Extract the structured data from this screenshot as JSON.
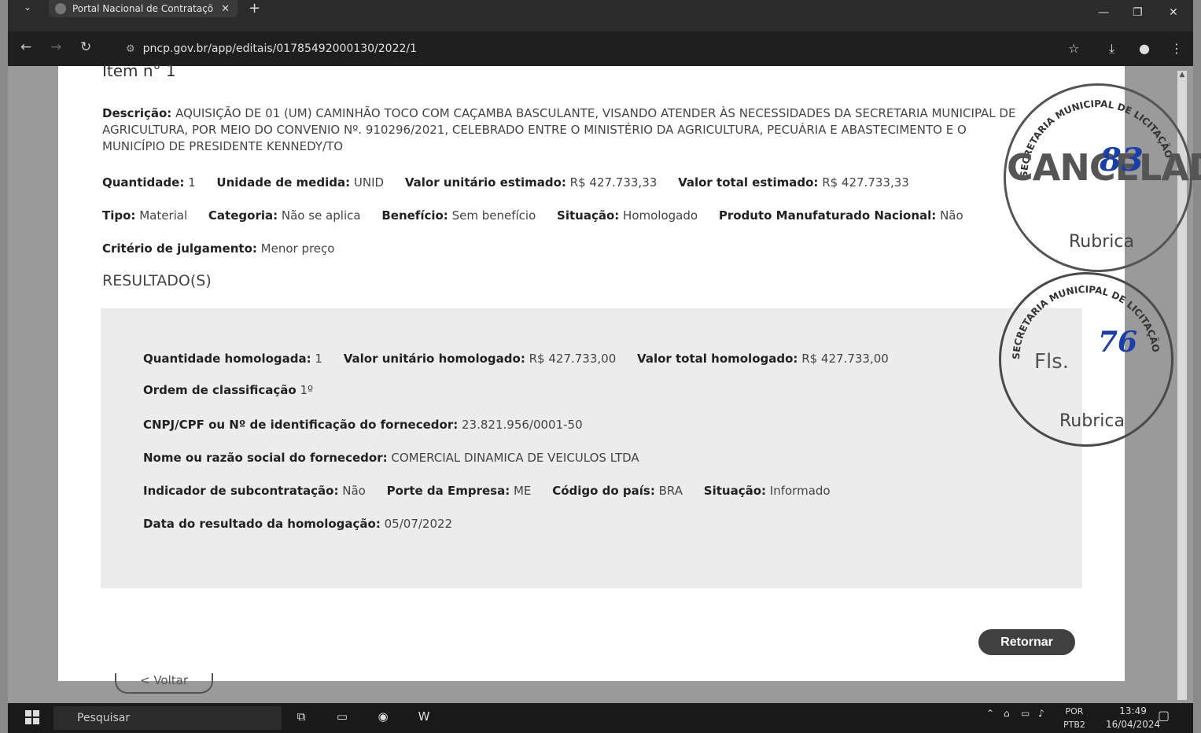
{
  "browser": {
    "tab_title": "Portal Nacional de Contrataçõ",
    "url": "pncp.gov.br/app/editais/01785492000130/2022/1"
  },
  "item": {
    "title": "Item n° 1",
    "descricao_label": "Descrição:",
    "descricao_value": "AQUISIÇÃO DE 01 (UM) CAMINHÃO TOCO COM CAÇAMBA BASCULANTE, VISANDO ATENDER ÀS NECESSIDADES DA SECRETARIA MUNICIPAL DE AGRICULTURA, POR MEIO DO CONVENIO Nº. 910296/2021, CELEBRADO ENTRE O MINISTÉRIO DA AGRICULTURA, PECUÁRIA E ABASTECIMENTO E O MUNICÍPIO DE PRESIDENTE KENNEDY/TO",
    "quantidade_label": "Quantidade:",
    "quantidade_value": "1",
    "unidade_label": "Unidade de medida:",
    "unidade_value": "UNID",
    "valor_unit_label": "Valor unitário estimado:",
    "valor_unit_value": "R$ 427.733,33",
    "valor_total_label": "Valor total estimado:",
    "valor_total_value": "R$ 427.733,33",
    "tipo_label": "Tipo:",
    "tipo_value": "Material",
    "categoria_label": "Categoria:",
    "categoria_value": "Não se aplica",
    "beneficio_label": "Benefício:",
    "beneficio_value": "Sem benefício",
    "situacao_label": "Situação:",
    "situacao_value": "Homologado",
    "produto_label": "Produto Manufaturado Nacional:",
    "produto_value": "Não",
    "criterio_label": "Critério de julgamento:",
    "criterio_value": "Menor preço"
  },
  "resultado": {
    "heading": "RESULTADO(S)",
    "qtd_label": "Quantidade homologada:",
    "qtd_value": "1",
    "vu_label": "Valor unitário homologado:",
    "vu_value": "R$ 427.733,00",
    "vt_label": "Valor total homologado:",
    "vt_value": "R$ 427.733,00",
    "ordem_label": "Ordem de classificação",
    "ordem_value": "1º",
    "cnpj_label": "CNPJ/CPF ou Nº de identificação do fornecedor:",
    "cnpj_value": "23.821.956/0001-50",
    "nome_label": "Nome ou razão social do fornecedor:",
    "nome_value": "COMERCIAL DINAMICA DE VEICULOS LTDA",
    "subcontr_label": "Indicador de subcontratação:",
    "subcontr_value": "Não",
    "porte_label": "Porte da Empresa:",
    "porte_value": "ME",
    "pais_label": "Código do país:",
    "pais_value": "BRA",
    "sit_label": "Situação:",
    "sit_value": "Informado",
    "data_label": "Data do resultado da homologação:",
    "data_value": "05/07/2022"
  },
  "buttons": {
    "retornar": "Retornar",
    "voltar": "< Voltar"
  },
  "stamps": {
    "stamp1_text": "SECRETARIA MUNICIPAL DE LICITAÇÃO",
    "stamp1_big": "CANCELADO",
    "stamp1_rubrica": "Rubrica",
    "stamp1_ink": "83",
    "stamp2_text": "SECRETARIA MUNICIPAL DE LICITAÇÃO",
    "stamp2_fls": "Fls.",
    "stamp2_ink": "76",
    "stamp2_rubrica": "Rubrica"
  },
  "taskbar": {
    "search_placeholder": "Pesquisar",
    "lang_top": "POR",
    "lang_bottom": "PTB2",
    "time": "13:49",
    "date": "16/04/2024"
  }
}
